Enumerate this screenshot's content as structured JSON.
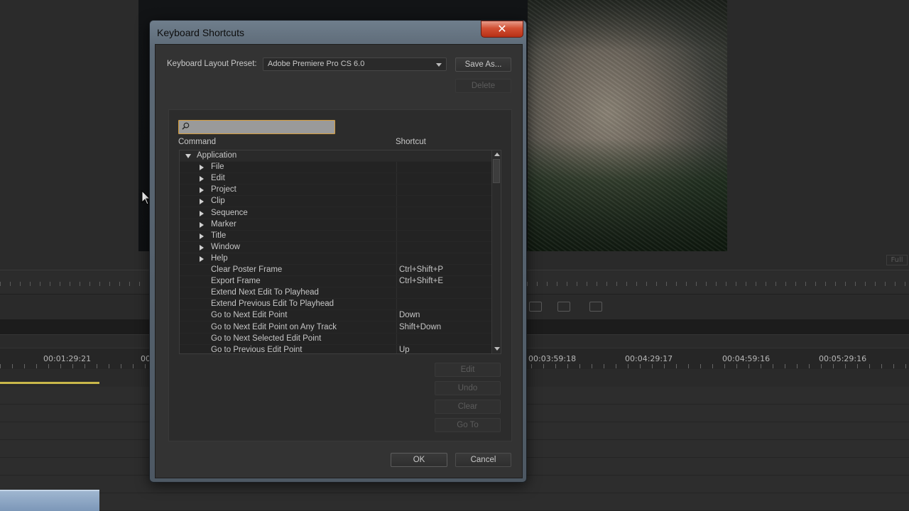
{
  "background": {
    "full_label": "Full",
    "timecodes": [
      "00:01:29:21",
      "00",
      "00:03:59:18",
      "00:04:29:17",
      "00:04:59:16",
      "00:05:29:16"
    ]
  },
  "dialog": {
    "title": "Keyboard Shortcuts",
    "close_glyph": "✕",
    "preset_label": "Keyboard Layout Preset:",
    "preset_value": "Adobe Premiere Pro CS 6.0",
    "save_as_label": "Save As...",
    "delete_label": "Delete",
    "search": {
      "value": "",
      "placeholder": ""
    },
    "columns": {
      "command": "Command",
      "shortcut": "Shortcut"
    },
    "rows": [
      {
        "command": "Application",
        "shortcut": "",
        "kind": "expanded"
      },
      {
        "command": "File",
        "shortcut": "",
        "kind": "collapsed"
      },
      {
        "command": "Edit",
        "shortcut": "",
        "kind": "collapsed"
      },
      {
        "command": "Project",
        "shortcut": "",
        "kind": "collapsed"
      },
      {
        "command": "Clip",
        "shortcut": "",
        "kind": "collapsed"
      },
      {
        "command": "Sequence",
        "shortcut": "",
        "kind": "collapsed"
      },
      {
        "command": "Marker",
        "shortcut": "",
        "kind": "collapsed"
      },
      {
        "command": "Title",
        "shortcut": "",
        "kind": "collapsed"
      },
      {
        "command": "Window",
        "shortcut": "",
        "kind": "collapsed"
      },
      {
        "command": "Help",
        "shortcut": "",
        "kind": "collapsed"
      },
      {
        "command": "Clear Poster Frame",
        "shortcut": "Ctrl+Shift+P",
        "kind": "item"
      },
      {
        "command": "Export Frame",
        "shortcut": "Ctrl+Shift+E",
        "kind": "item"
      },
      {
        "command": "Extend Next Edit To Playhead",
        "shortcut": "",
        "kind": "item"
      },
      {
        "command": "Extend Previous Edit To Playhead",
        "shortcut": "",
        "kind": "item"
      },
      {
        "command": "Go to Next Edit Point",
        "shortcut": "Down",
        "kind": "item"
      },
      {
        "command": "Go to Next Edit Point on Any Track",
        "shortcut": "Shift+Down",
        "kind": "item"
      },
      {
        "command": "Go to Next Selected Edit Point",
        "shortcut": "",
        "kind": "item"
      },
      {
        "command": "Go to Previous Edit Point",
        "shortcut": "Up",
        "kind": "item"
      }
    ],
    "edit_label": "Edit",
    "undo_label": "Undo",
    "clear_label": "Clear",
    "goto_label": "Go To",
    "ok_label": "OK",
    "cancel_label": "Cancel"
  }
}
